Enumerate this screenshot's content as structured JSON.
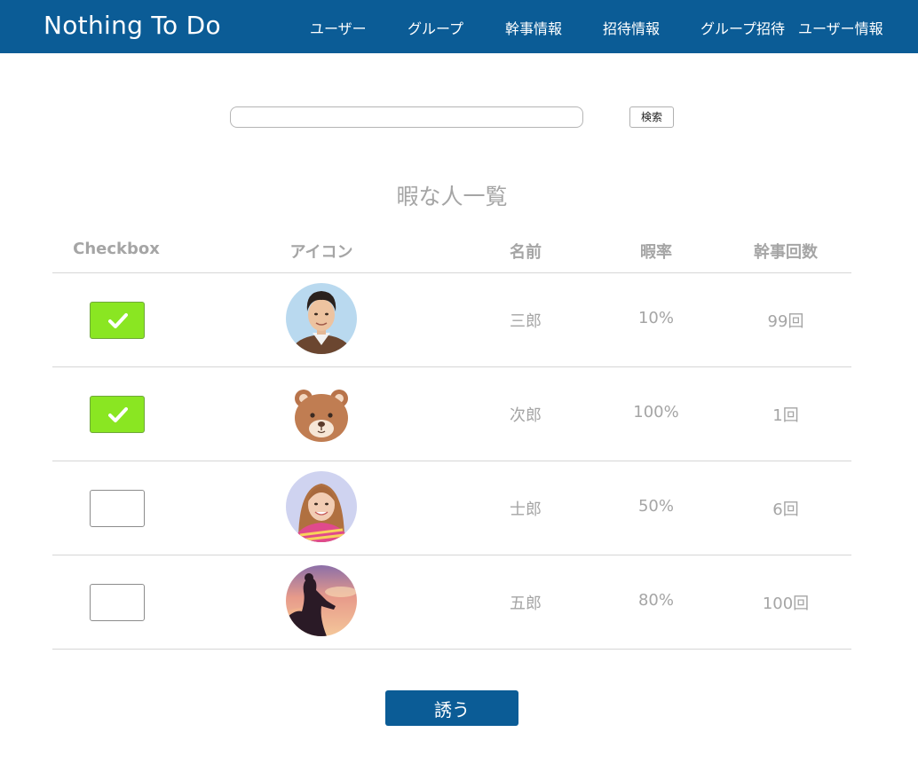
{
  "header": {
    "brand": "Nothing To Do",
    "nav": [
      "ユーザー",
      "グループ",
      "幹事情報",
      "招待情報",
      "グループ招待",
      "ユーザー情報"
    ]
  },
  "search": {
    "value": "",
    "button_label": "検索"
  },
  "section_title": "暇な人一覧",
  "table": {
    "columns": [
      "Checkbox",
      "アイコン",
      "名前",
      "暇率",
      "幹事回数"
    ],
    "rows": [
      {
        "checked": true,
        "avatar_icon": "man-photo-avatar",
        "name": "三郎",
        "free_rate": "10%",
        "organizer_count": "99回"
      },
      {
        "checked": true,
        "avatar_icon": "bear-avatar",
        "name": "次郎",
        "free_rate": "100%",
        "organizer_count": "1回"
      },
      {
        "checked": false,
        "avatar_icon": "woman-photo-avatar",
        "name": "士郎",
        "free_rate": "50%",
        "organizer_count": "6回"
      },
      {
        "checked": false,
        "avatar_icon": "silhouette-sunset-avatar",
        "name": "五郎",
        "free_rate": "80%",
        "organizer_count": "100回"
      }
    ]
  },
  "invite_button_label": "誘う",
  "colors": {
    "header_bg": "#0b5c96",
    "checkbox_checked": "#8ae622",
    "muted_text": "#a5a5a5",
    "button_bg": "#0b5c96"
  }
}
